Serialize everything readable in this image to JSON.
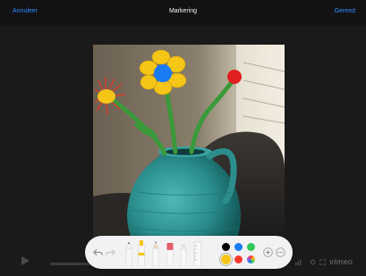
{
  "navbar": {
    "cancel_label": "Annuleer",
    "title": "Markering",
    "done_label": "Gereed"
  },
  "video_player": {
    "brand": "vimeo"
  },
  "toolbar": {
    "undo_icon": "undo-icon",
    "redo_icon": "redo-icon",
    "tools": [
      {
        "name": "pen",
        "tip_color": "#1a1a1a"
      },
      {
        "name": "marker",
        "tip_color": "#f5c518"
      },
      {
        "name": "pencil",
        "tip_color": "#e8e8e8"
      },
      {
        "name": "eraser",
        "tip_color": "#e65a6a"
      },
      {
        "name": "lasso",
        "tip_color": "#d0d0d0"
      },
      {
        "name": "ruler",
        "tip_color": "#e0e0e0"
      }
    ],
    "colors": [
      {
        "name": "black",
        "hex": "#000000"
      },
      {
        "name": "blue",
        "hex": "#1a7cf5"
      },
      {
        "name": "green",
        "hex": "#34c759"
      },
      {
        "name": "yellow",
        "hex": "#f5c518",
        "selected": true
      },
      {
        "name": "red",
        "hex": "#ff3b30"
      },
      {
        "name": "color-picker",
        "hex": "multicolor"
      }
    ],
    "add_icon": "add-icon",
    "more_icon": "more-icon"
  },
  "drawing": {
    "flowers": [
      {
        "petal_color": "#f5c518",
        "center_color": "#1a7cf5"
      },
      {
        "petal_color": "#e03a2a",
        "center_color": "#f5c518"
      },
      {
        "petal_color": "#e02020",
        "center_color": "#e02020"
      }
    ],
    "stem_color": "#3a9a3a"
  }
}
